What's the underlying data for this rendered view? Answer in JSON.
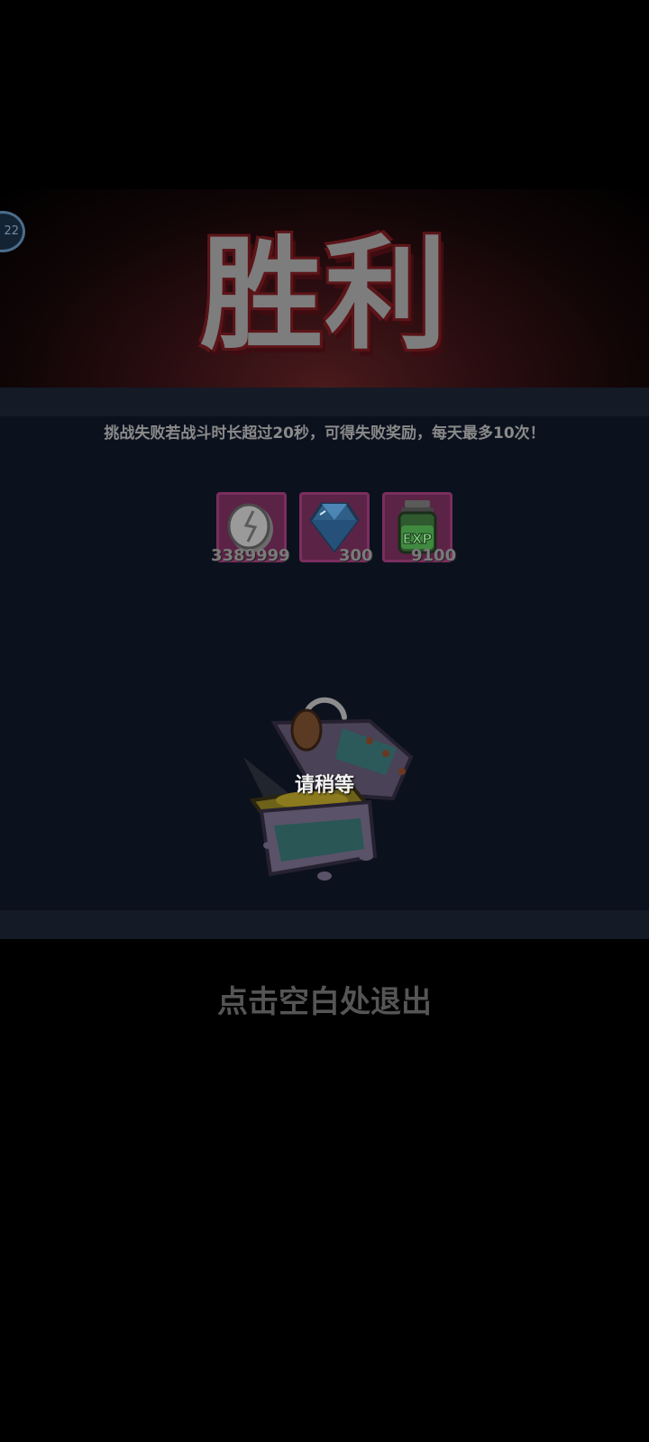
{
  "result": {
    "title": "胜利",
    "level": "22"
  },
  "notice": "挑战失败若战斗时长超过20秒，可得失败奖励，每天最多10次！",
  "rewards": [
    {
      "icon": "silver-coin-icon",
      "count": "3389999"
    },
    {
      "icon": "diamond-icon",
      "count": "300"
    },
    {
      "icon": "exp-potion-icon",
      "count": "9100"
    }
  ],
  "chest": {
    "status": "请稍等"
  },
  "exit_hint": "点击空白处退出"
}
